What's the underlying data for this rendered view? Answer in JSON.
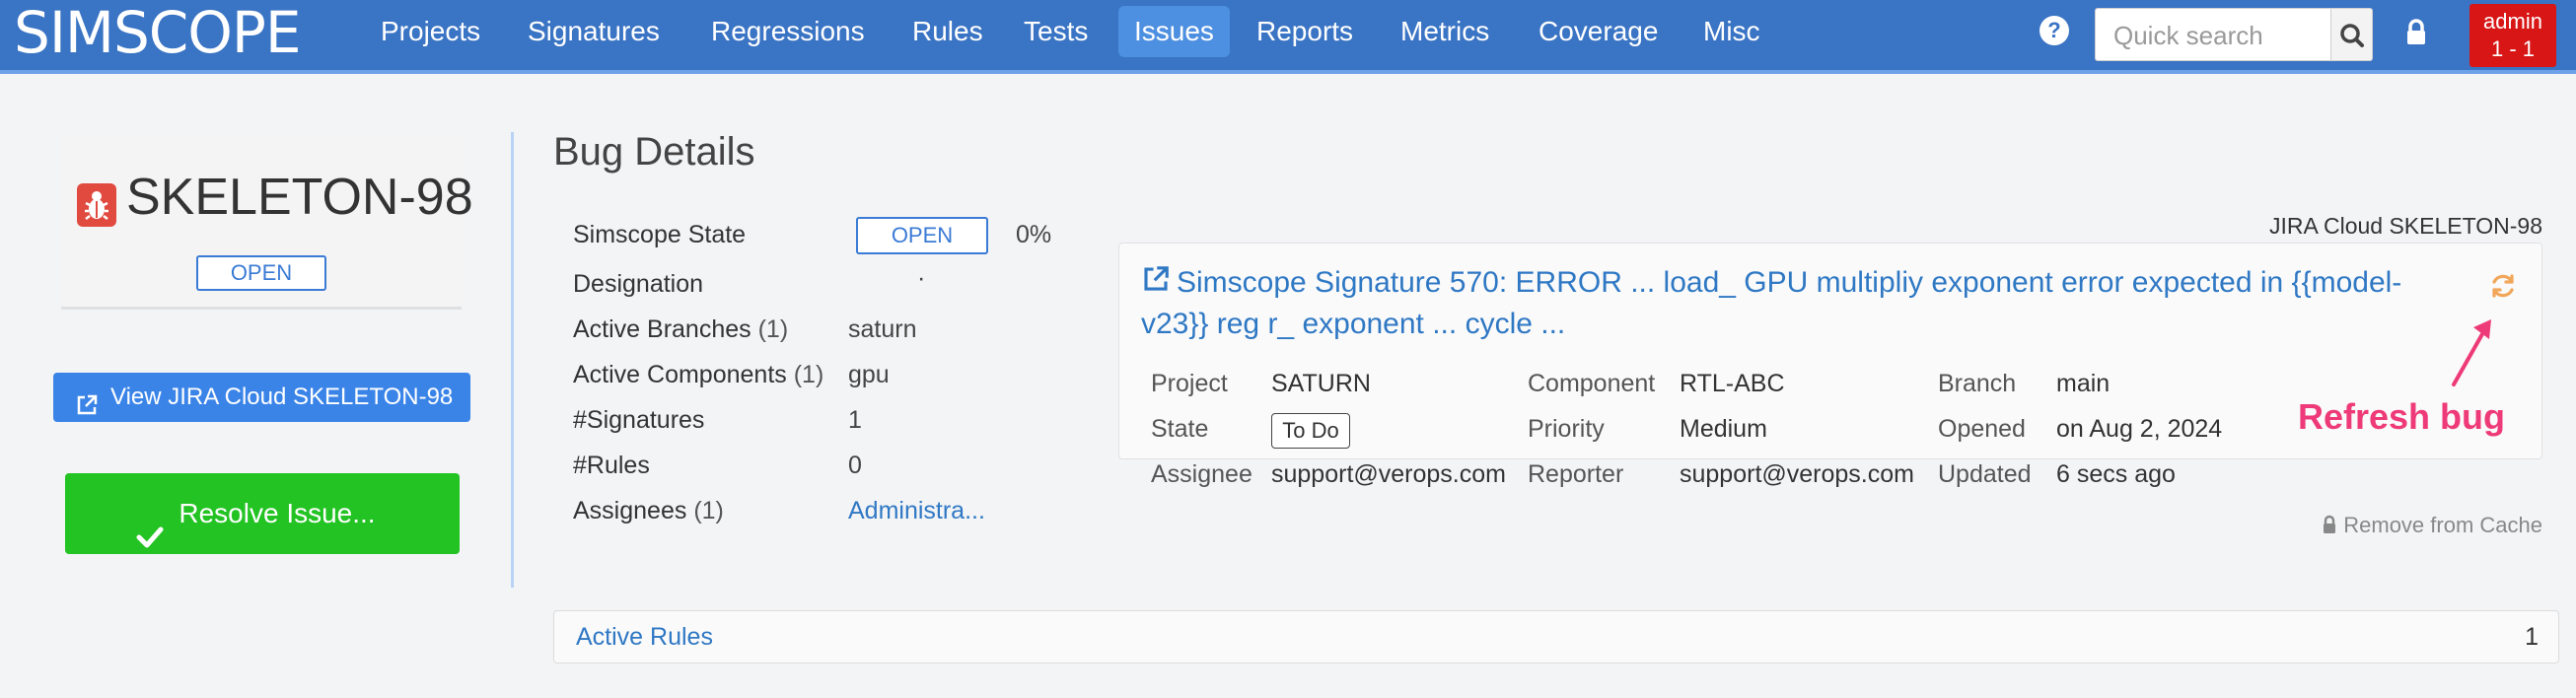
{
  "navbar": {
    "brand": "SIMSCOPE",
    "items": [
      "Projects",
      "Signatures",
      "Regressions",
      "Rules",
      "Tests",
      "Issues",
      "Reports",
      "Metrics",
      "Coverage",
      "Misc"
    ],
    "active_item": "Issues",
    "help_icon": "question-circle-icon",
    "search_placeholder": "Quick search",
    "user": "admin",
    "user_counts": "1 - 1",
    "accent_color": "#3a74c4",
    "user_badge_color": "#d81616"
  },
  "left_panel": {
    "bug_id": "SKELETON-98",
    "status": "OPEN",
    "view_button": "View JIRA Cloud SKELETON-98",
    "resolve_button": "Resolve Issue..."
  },
  "details": {
    "title": "Bug Details",
    "simscope_state_label": "Simscope State",
    "simscope_state": "OPEN",
    "progress": "0%",
    "designation_label": "Designation",
    "designation": "·",
    "active_branches_label": "Active Branches",
    "active_branches_count": "(1)",
    "active_branches": "saturn",
    "active_components_label": "Active Components",
    "active_components_count": "(1)",
    "active_components": "gpu",
    "signatures_label": "#Signatures",
    "signatures": "1",
    "rules_label": "#Rules",
    "rules": "0",
    "assignees_label": "Assignees",
    "assignees_count": "(1)",
    "assignees": "Administra..."
  },
  "jira": {
    "header": "JIRA Cloud SKELETON-98",
    "title": "Simscope Signature 570: ERROR ... load_ GPU multipliy exponent error expected in {{model-v23}} reg r_ exponent ... cycle ...",
    "project_label": "Project",
    "project": "SATURN",
    "component_label": "Component",
    "component": "RTL-ABC",
    "branch_label": "Branch",
    "branch": "main",
    "state_label": "State",
    "state": "To Do",
    "priority_label": "Priority",
    "priority": "Medium",
    "opened_label": "Opened",
    "opened": "on Aug 2, 2024",
    "assignee_label": "Assignee",
    "assignee": "support@verops.com",
    "reporter_label": "Reporter",
    "reporter": "support@verops.com",
    "updated_label": "Updated",
    "updated": "6 secs ago",
    "annotation": "Refresh bug",
    "remove_cache": "Remove from Cache"
  },
  "active_rules": {
    "label": "Active Rules",
    "count": "1"
  }
}
